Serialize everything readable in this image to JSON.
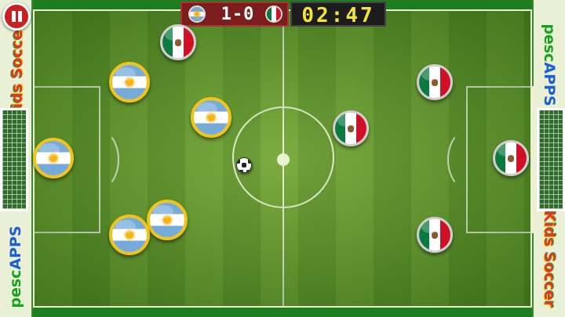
{
  "hud": {
    "score": "1-0",
    "timer": "02:47",
    "home_team": "Argentina",
    "away_team": "Mexico"
  },
  "branding": {
    "kids_soccer": "Kids Soccer",
    "pesc_apps_prefix": "pesc",
    "pesc_apps_suffix": "APPS"
  },
  "icons": {
    "pause": "pause-icon",
    "ball": "soccer-ball-icon",
    "argentina_flag": "argentina-flag-icon",
    "mexico_flag": "mexico-flag-icon"
  },
  "colors": {
    "pitch_light": "#6aa12e",
    "pitch_dark": "#5c9326",
    "argentina_blue": "#75aadb",
    "argentina_cap_rim": "#f0c419",
    "mexico_green": "#0b7a3f",
    "mexico_red": "#ce1126",
    "score_bg": "#7c1d1d",
    "timer_digits": "#f1e33a",
    "pause_button": "#c62222"
  }
}
